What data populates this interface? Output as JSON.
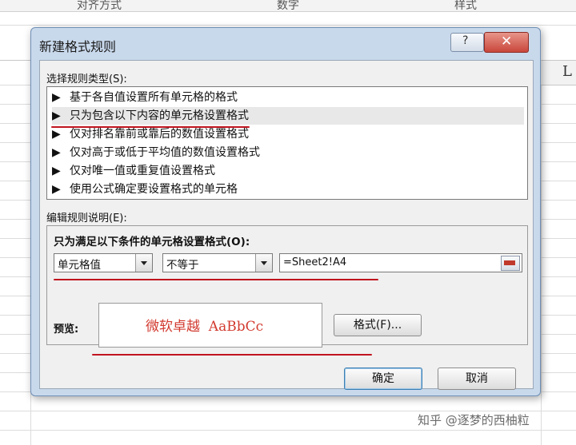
{
  "ribbon": {
    "groups": [
      "对齐方式",
      "数字",
      "样式"
    ]
  },
  "spreadsheet": {
    "column_header": "L"
  },
  "dialog": {
    "title": "新建格式规则",
    "help_glyph": "?",
    "close_glyph": "✕",
    "rule_type_label": "选择规则类型(S):",
    "rule_types": [
      "基于各自值设置所有单元格的格式",
      "只为包含以下内容的单元格设置格式",
      "仅对排名靠前或靠后的数值设置格式",
      "仅对高于或低于平均值的数值设置格式",
      "仅对唯一值或重复值设置格式",
      "使用公式确定要设置格式的单元格"
    ],
    "selected_rule_index": 1,
    "rule_arrow_glyph": "▶",
    "edit_desc_label": "编辑规则说明(E):",
    "condition_title": "只为满足以下条件的单元格设置格式(O):",
    "condition_field": "单元格值",
    "condition_operator": "不等于",
    "condition_value": "=Sheet2!A4",
    "preview_label": "预览:",
    "preview_text": "微软卓越  AaBbCc",
    "format_button": "格式(F)...",
    "ok_button": "确定",
    "cancel_button": "取消",
    "colors": {
      "preview_text": "#d23a2f",
      "annotation_line": "#c0141e",
      "title_bar": "#c9d9ec"
    }
  },
  "watermark": "知乎 @逐梦的西柚粒"
}
